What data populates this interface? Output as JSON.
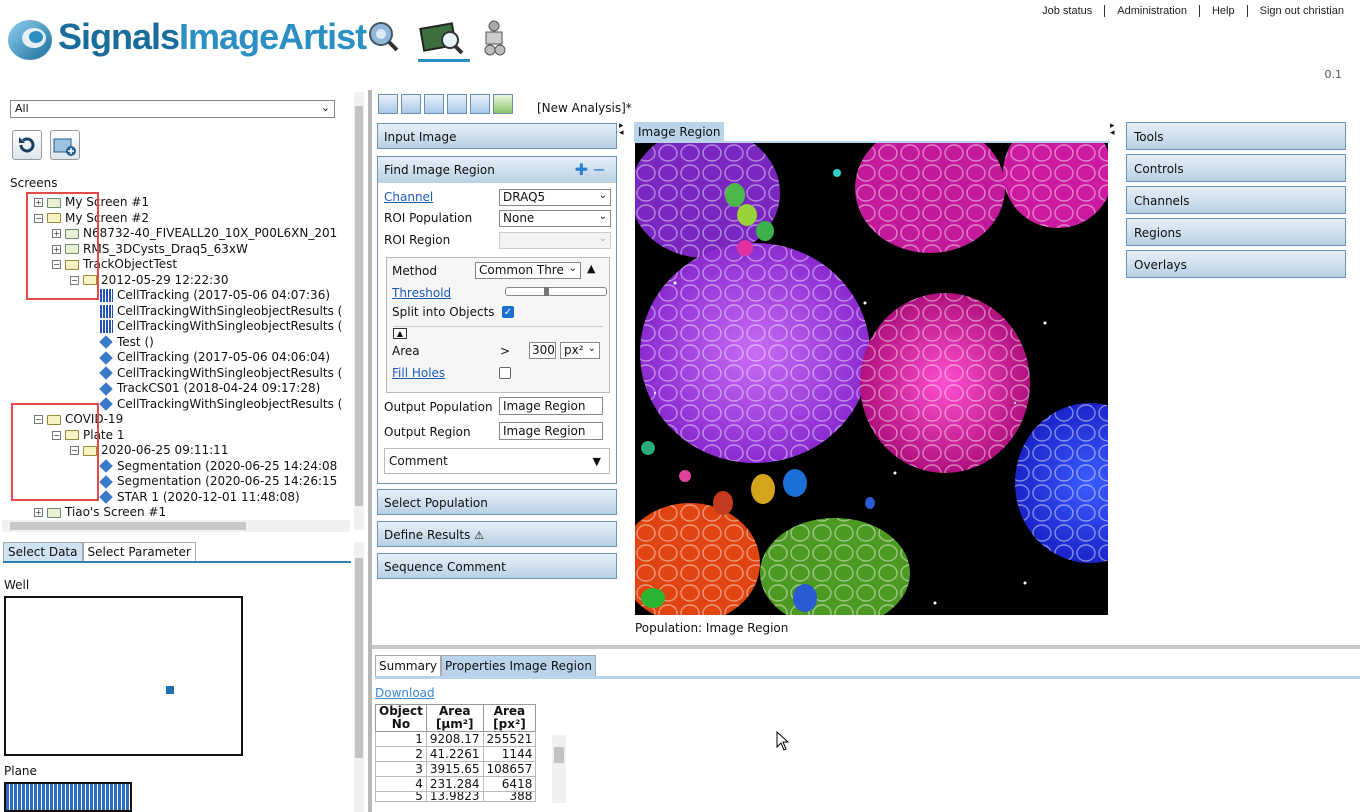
{
  "brand": {
    "part1": "Signals",
    "part2": "ImageArtist"
  },
  "topnav": [
    "Job status",
    "Administration",
    "Help",
    "Sign out christian"
  ],
  "version": "0.1",
  "left": {
    "filter_value": "All",
    "screens_label": "Screens",
    "tree": [
      {
        "label": "My Screen #1",
        "type": "folder",
        "expander": "+"
      },
      {
        "label": "My Screen #2",
        "type": "folder-open",
        "expander": "−"
      },
      {
        "label": "N68732-40_FIVEALL20_10X_P00L6XN_201",
        "type": "folder",
        "expander": "+"
      },
      {
        "label": "RMS_3DCysts_Draq5_63xW",
        "type": "folder",
        "expander": "+"
      },
      {
        "label": "TrackObjectTest",
        "type": "folder-open",
        "expander": "−"
      },
      {
        "label": "2012-05-29 12:22:30",
        "type": "folder-open",
        "expander": "−"
      },
      {
        "label": "CellTracking (2017-05-06 04:07:36)",
        "type": "plate"
      },
      {
        "label": "CellTrackingWithSingleobjectResults (",
        "type": "plate"
      },
      {
        "label": "CellTrackingWithSingleobjectResults (",
        "type": "plate"
      },
      {
        "label": "Test ()",
        "type": "analysis"
      },
      {
        "label": "CellTracking (2017-05-06 04:06:04)",
        "type": "analysis"
      },
      {
        "label": "CellTrackingWithSingleobjectResults (",
        "type": "analysis"
      },
      {
        "label": "TrackCS01 (2018-04-24 09:17:28)",
        "type": "analysis"
      },
      {
        "label": "CellTrackingWithSingleobjectResults (",
        "type": "analysis"
      },
      {
        "label": "COVID-19",
        "type": "folder-open",
        "expander": "−"
      },
      {
        "label": "Plate 1",
        "type": "folder-open",
        "expander": "−"
      },
      {
        "label": "2020-06-25 09:11:11",
        "type": "folder-open",
        "expander": "−"
      },
      {
        "label": "Segmentation (2020-06-25 14:24:08",
        "type": "analysis"
      },
      {
        "label": "Segmentation (2020-06-25 14:26:15",
        "type": "analysis"
      },
      {
        "label": "STAR 1 (2020-12-01 11:48:08)",
        "type": "analysis"
      },
      {
        "label": "Tiao's Screen #1",
        "type": "folder",
        "expander": "+"
      }
    ],
    "tabs": [
      "Select Data",
      "Select Parameter"
    ],
    "well_label": "Well",
    "plane_label": "Plane"
  },
  "analysis": {
    "title": "[New Analysis]*",
    "input_image": "Input Image",
    "find_region": "Find Image Region",
    "channel_label": "Channel",
    "channel_value": "DRAQ5",
    "roi_pop_label": "ROI Population",
    "roi_pop_value": "None",
    "roi_region_label": "ROI Region",
    "method_label": "Method",
    "method_value": "Common Thre",
    "threshold_label": "Threshold",
    "threshold_level": 0.38,
    "split_label": "Split into Objects",
    "area_label": "Area",
    "area_op": ">",
    "area_value": "300",
    "area_unit": "px²",
    "fill_holes": "Fill Holes",
    "out_pop_label": "Output Population",
    "out_pop_value": "Image Region",
    "out_region_label": "Output Region",
    "out_region_value": "Image Region",
    "comment": "Comment",
    "select_population": "Select Population",
    "define_results": "Define Results",
    "sequence_comment": "Sequence Comment"
  },
  "image": {
    "tab": "Image Region",
    "population": "Population: Image Region"
  },
  "tools": [
    "Tools",
    "Controls",
    "Channels",
    "Regions",
    "Overlays"
  ],
  "results": {
    "tabs": [
      "Summary",
      "Properties Image Region"
    ],
    "download": "Download",
    "headers": [
      [
        "Object",
        "No"
      ],
      [
        "Area",
        "[µm²]"
      ],
      [
        "Area",
        "[px²]"
      ]
    ],
    "rows": [
      [
        "1",
        "9208.17",
        "255521"
      ],
      [
        "2",
        "41.2261",
        "1144"
      ],
      [
        "3",
        "3915.65",
        "108657"
      ],
      [
        "4",
        "231.284",
        "6418"
      ],
      [
        "5",
        "13.9823",
        "388"
      ]
    ]
  }
}
